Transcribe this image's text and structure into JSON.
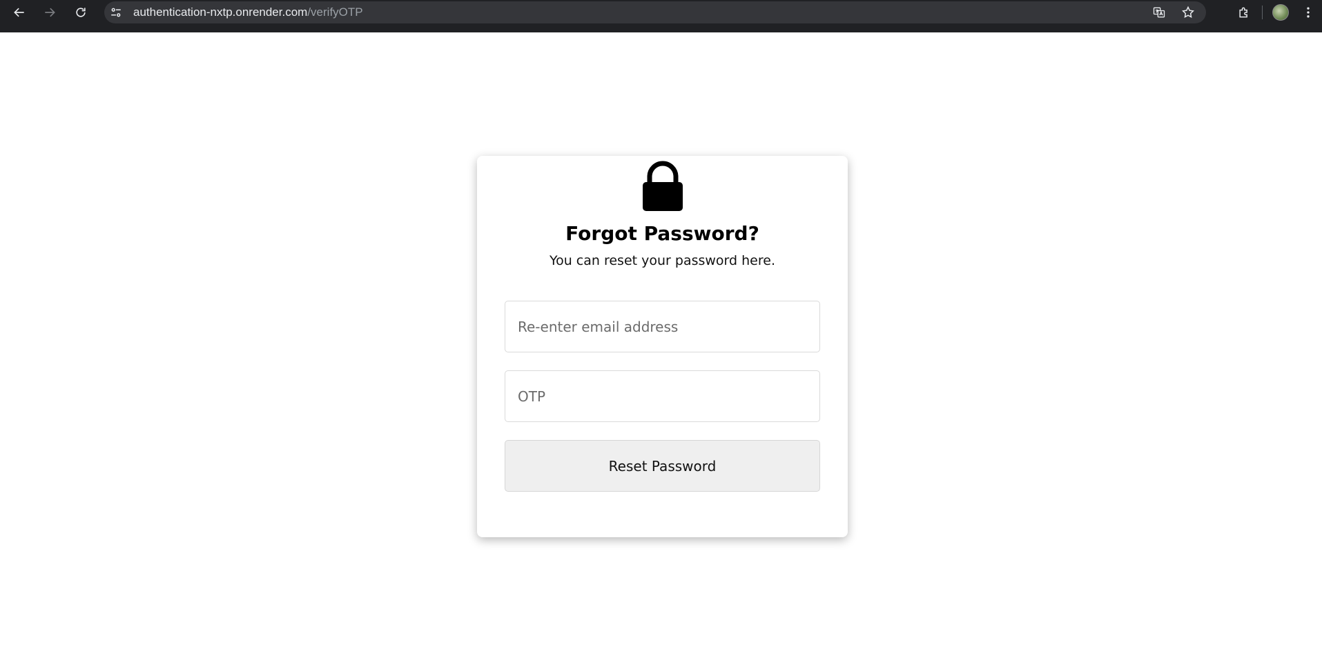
{
  "browser": {
    "url_host": "authentication-nxtp.onrender.com",
    "url_path": "/verifyOTP",
    "icons": [
      "back-icon",
      "forward-icon",
      "reload-icon",
      "site-info-icon",
      "translate-icon",
      "bookmark-star-icon",
      "extensions-icon",
      "profile-avatar",
      "more-menu-icon"
    ]
  },
  "card": {
    "icon": "lock-icon",
    "title": "Forgot Password?",
    "subtitle": "You can reset your password here.",
    "email": {
      "value": "",
      "placeholder": "Re-enter email address"
    },
    "otp": {
      "value": "",
      "placeholder": "OTP"
    },
    "submit_label": "Reset Password"
  },
  "colors": {
    "toolbar_bg": "#202124",
    "omnibox_bg": "#35363a",
    "button_bg": "#efefef",
    "page_bg": "#ffffff"
  }
}
